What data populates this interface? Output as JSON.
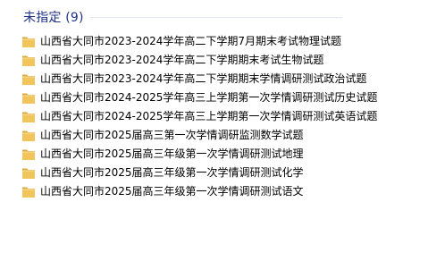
{
  "group": {
    "title": "未指定 (9)"
  },
  "files": [
    {
      "name": "山西省大同市2023-2024学年高二下学期7月期末考试物理试题",
      "icon": "folder-icon"
    },
    {
      "name": "山西省大同市2023-2024学年高二下学期期末考试生物试题",
      "icon": "folder-icon"
    },
    {
      "name": "山西省大同市2023-2024学年高二下学期期末学情调研测试政治试题",
      "icon": "folder-icon"
    },
    {
      "name": "山西省大同市2024-2025学年高三上学期第一次学情调研测试历史试题",
      "icon": "folder-icon"
    },
    {
      "name": "山西省大同市2024-2025学年高三上学期第一次学情调研测试英语试题",
      "icon": "folder-icon"
    },
    {
      "name": "山西省大同市2025届高三第一次学情调研监测数学试题",
      "icon": "folder-icon"
    },
    {
      "name": "山西省大同市2025届高三年级第一次学情调研测试地理",
      "icon": "folder-icon"
    },
    {
      "name": "山西省大同市2025届高三年级第一次学情调研测试化学",
      "icon": "folder-icon"
    },
    {
      "name": "山西省大同市2025届高三年级第一次学情调研测试语文",
      "icon": "folder-icon"
    }
  ],
  "colors": {
    "group_header": "#1e3287",
    "folder_front": "#f2c55c",
    "folder_back": "#dcaa3c"
  }
}
